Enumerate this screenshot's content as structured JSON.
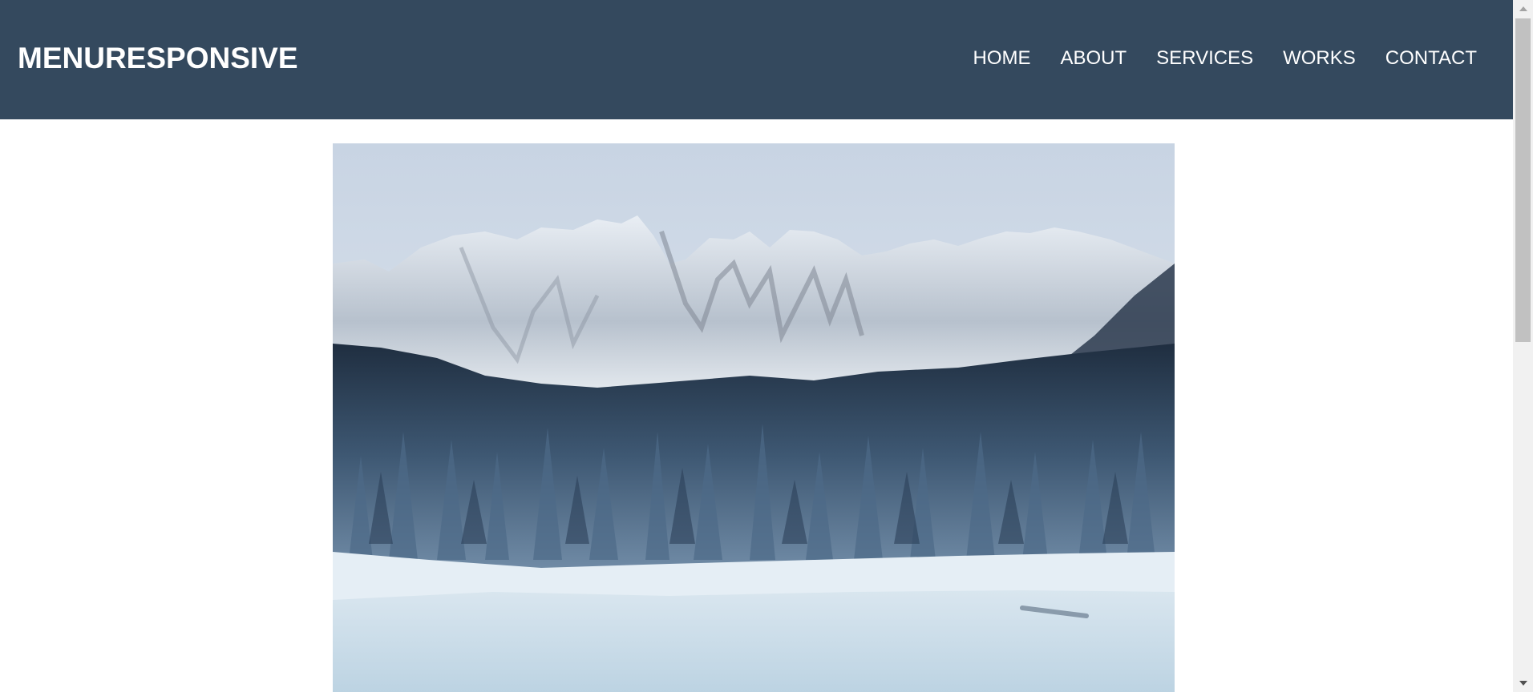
{
  "header": {
    "brand": "MENURESPONSIVE",
    "nav": [
      {
        "label": "HOME"
      },
      {
        "label": "ABOUT"
      },
      {
        "label": "SERVICES"
      },
      {
        "label": "WORKS"
      },
      {
        "label": "CONTACT"
      }
    ],
    "background_color": "#34495e",
    "text_color": "#ffffff"
  },
  "hero": {
    "image": "snowy-mountain-forest-frozen-lake-photo"
  },
  "scrollbar": {
    "up_icon": "scroll-up-arrow-icon",
    "down_icon": "scroll-down-arrow-icon"
  }
}
